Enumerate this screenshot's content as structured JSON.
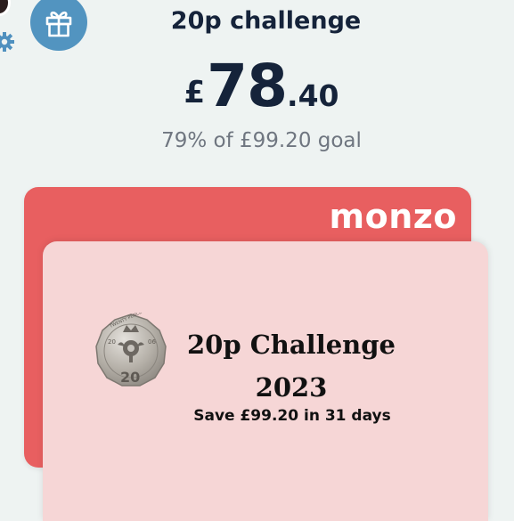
{
  "header": {
    "title": "20p challenge",
    "avatar_icon": "avatar-icon",
    "settings_icon": "gear-icon",
    "gift_icon": "gift-icon"
  },
  "balance": {
    "currency": "£",
    "major": "78",
    "minor": ".40"
  },
  "goal": {
    "text": "79% of £99.20 goal"
  },
  "card": {
    "brand": "monzo",
    "title_line1": "20p Challenge",
    "title_line2": "2023",
    "subtitle": "Save £99.20 in 31 days",
    "coin_text_top": "TWENTY PENCE",
    "coin_year": "2006",
    "coin_value": "20"
  },
  "colors": {
    "accent": "#5294c0",
    "card_back": "#e85f60",
    "card_front": "#f6d6d6",
    "text_dark": "#15233a",
    "text_muted": "#6f7680"
  }
}
